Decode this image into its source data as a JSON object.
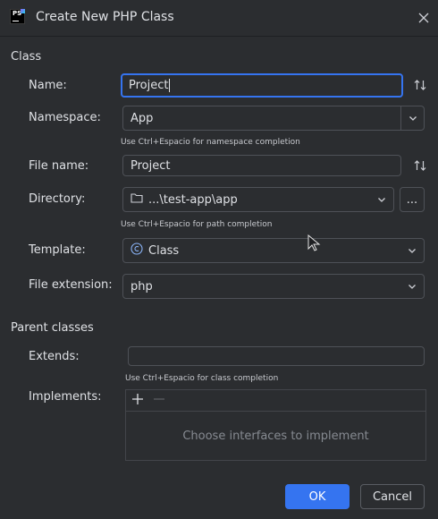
{
  "window": {
    "title": "Create New PHP Class",
    "app_icon": "phpstorm-icon",
    "app_icon_text": "PS"
  },
  "sections": {
    "class": "Class",
    "parent": "Parent classes"
  },
  "fields": {
    "name": {
      "label": "Name:",
      "value": "Project"
    },
    "namespace": {
      "label": "Namespace:",
      "value": "App",
      "hint": "Use Ctrl+Espacio for namespace completion"
    },
    "file_name": {
      "label": "File name:",
      "value": "Project"
    },
    "directory": {
      "label": "Directory:",
      "value": "...\\test-app\\app",
      "hint": "Use Ctrl+Espacio for path completion",
      "browse": "..."
    },
    "template": {
      "label": "Template:",
      "value": "Class"
    },
    "file_extension": {
      "label": "File extension:",
      "value": "php"
    },
    "extends": {
      "label": "Extends:",
      "value": "",
      "hint": "Use Ctrl+Espacio for class completion"
    },
    "implements": {
      "label": "Implements:",
      "empty_text": "Choose interfaces to implement"
    }
  },
  "buttons": {
    "ok": "OK",
    "cancel": "Cancel"
  },
  "colors": {
    "background": "#2b2d30",
    "accent": "#3574f0",
    "border": "#4e5157",
    "text": "#dfe1e5",
    "muted": "#868a91"
  }
}
